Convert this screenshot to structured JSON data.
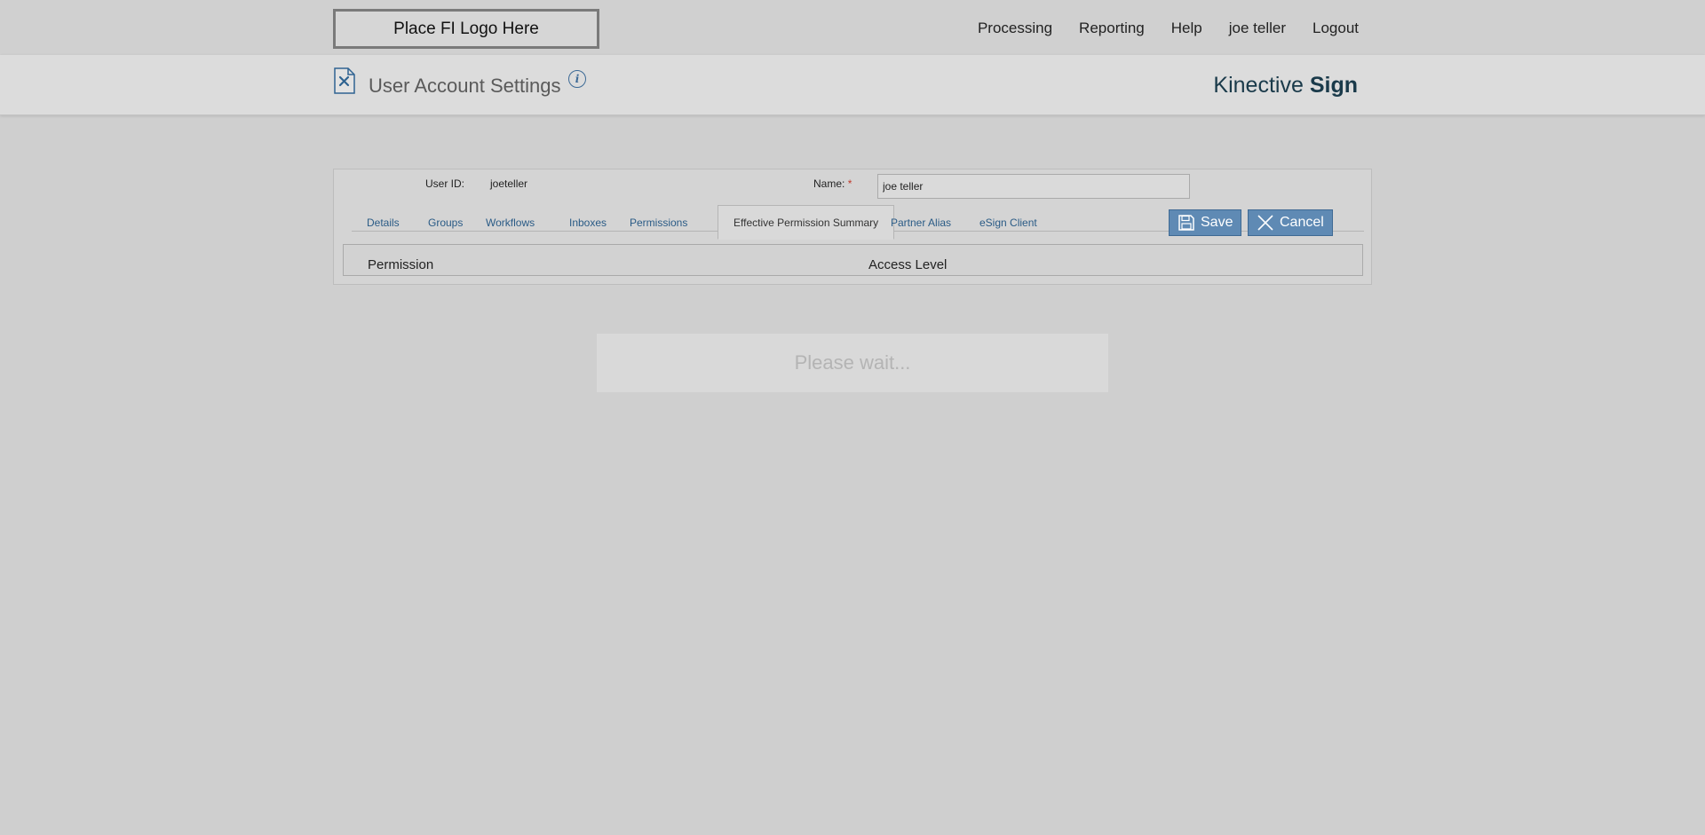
{
  "topbar": {
    "logo_text": "Place FI Logo Here",
    "nav": [
      {
        "label": "Processing"
      },
      {
        "label": "Reporting"
      },
      {
        "label": "Help"
      },
      {
        "label": "joe teller"
      },
      {
        "label": "Logout"
      }
    ]
  },
  "header": {
    "title": "User Account Settings",
    "info_icon": "info-icon",
    "brand_light": "Kinective",
    "brand_bold": "Sign"
  },
  "form": {
    "user_id_label": "User ID:",
    "user_id_value": "joeteller",
    "name_label": "Name:",
    "name_required_mark": "*",
    "name_value": "joe teller"
  },
  "tabs": [
    {
      "label": "Details"
    },
    {
      "label": "Groups"
    },
    {
      "label": "Workflows"
    },
    {
      "label": "Inboxes"
    },
    {
      "label": "Permissions"
    },
    {
      "label": "Effective Permission Summary"
    },
    {
      "label": "Partner Alias"
    },
    {
      "label": "eSign Client"
    }
  ],
  "active_tab": "Effective Permission Summary",
  "buttons": {
    "save_label": "Save",
    "cancel_label": "Cancel"
  },
  "table": {
    "columns": [
      "Permission",
      "Access Level"
    ]
  },
  "overlay": {
    "message": "Please wait..."
  },
  "colors": {
    "background": "#cfcfcf",
    "accent_button": "#5f8ab4",
    "link": "#2a5b86",
    "brand": "#1a3a4a",
    "required": "#c0392b"
  }
}
